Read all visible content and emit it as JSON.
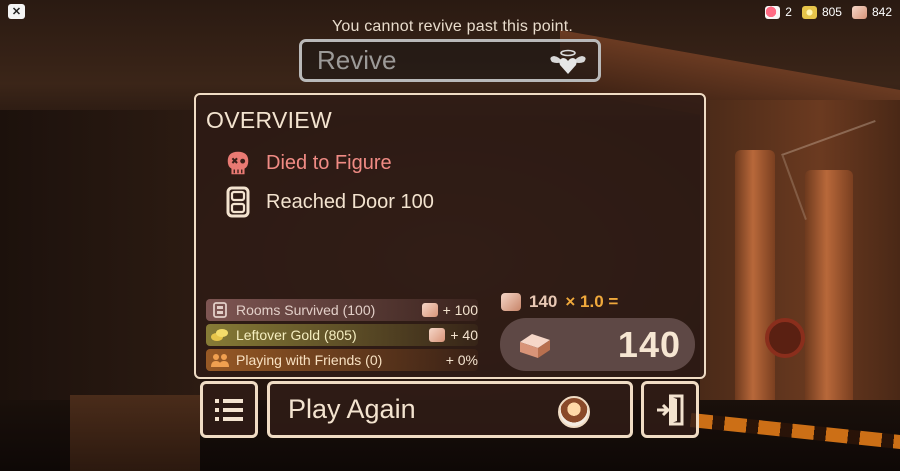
{
  "top_bar": {
    "close_label": "✕",
    "currencies": [
      {
        "icon": "revive-icon",
        "value": "2"
      },
      {
        "icon": "gold-icon",
        "value": "805"
      },
      {
        "icon": "knobs-icon",
        "value": "842"
      }
    ]
  },
  "revive": {
    "notice": "You cannot revive past this point.",
    "button_label": "Revive"
  },
  "overview": {
    "title": "OVERVIEW",
    "death_text": "Died to Figure",
    "door_text": "Reached Door 100",
    "bonuses": [
      {
        "label": "Rooms Survived (100)",
        "value": "+ 100"
      },
      {
        "label": "Leftover Gold (805)",
        "value": "+ 40"
      },
      {
        "label": "Playing with Friends (0)",
        "value": "+ 0%"
      }
    ],
    "formula": {
      "base": "140",
      "multiplier": "× 1.0 ="
    },
    "total": "140"
  },
  "bottom": {
    "play_again_label": "Play Again"
  },
  "colors": {
    "panel_border": "#f0dcc4",
    "death_text": "#f08b84",
    "formula_accent": "#f0a93c"
  }
}
